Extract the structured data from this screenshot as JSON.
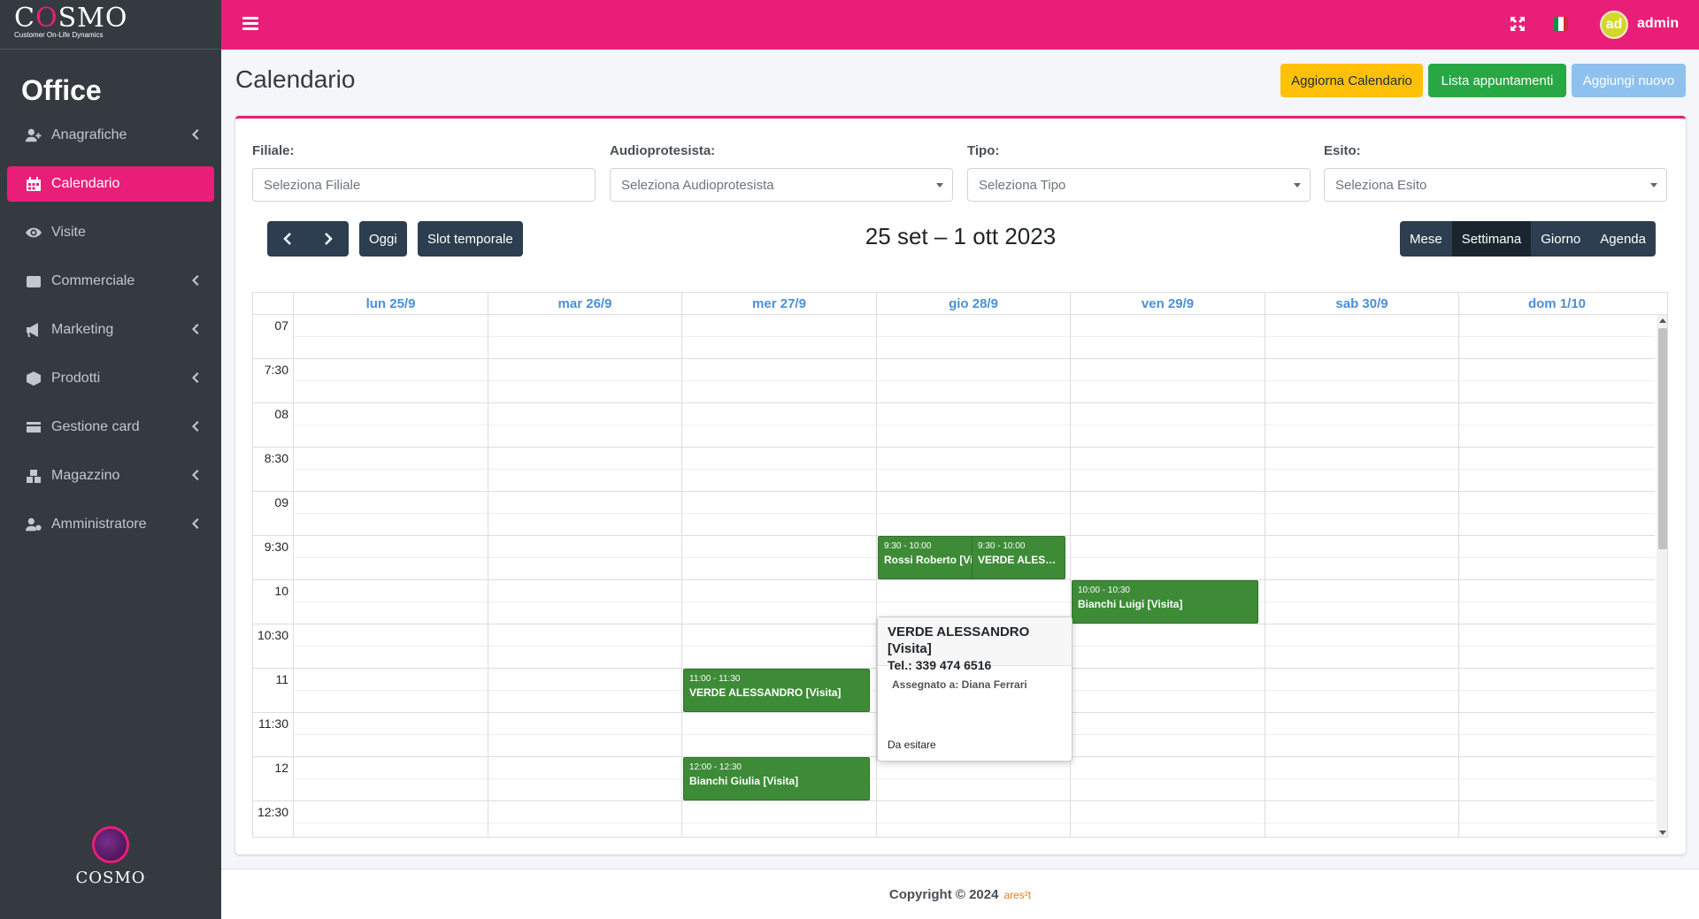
{
  "brand": {
    "logo_c": "C",
    "logo_o": "O",
    "logo_rest": "SMO",
    "subtitle": "Customer On-Life Dynamics"
  },
  "sidebar": {
    "title": "Office",
    "items": [
      {
        "label": "Anagrafiche",
        "icon": "user-plus-icon"
      },
      {
        "label": "Calendario",
        "icon": "calendar-icon"
      },
      {
        "label": "Visite",
        "icon": "eye-icon"
      },
      {
        "label": "Commerciale",
        "icon": "wallet-icon"
      },
      {
        "label": "Marketing",
        "icon": "megaphone-icon"
      },
      {
        "label": "Prodotti",
        "icon": "box-icon"
      },
      {
        "label": "Gestione card",
        "icon": "credit-card-icon"
      },
      {
        "label": "Magazzino",
        "icon": "warehouse-icon"
      },
      {
        "label": "Amministratore",
        "icon": "user-cog-icon"
      }
    ],
    "footer_text": "COSMO"
  },
  "topbar": {
    "avatar_initials": "ad",
    "username": "admin"
  },
  "page": {
    "title": "Calendario",
    "buttons": {
      "refresh": "Aggiorna Calendario",
      "list": "Lista appuntamenti",
      "add": "Aggiungi nuovo"
    }
  },
  "filters": [
    {
      "label": "Filiale:",
      "placeholder": "Seleziona Filiale"
    },
    {
      "label": "Audioprotesista:",
      "placeholder": "Seleziona Audioprotesista"
    },
    {
      "label": "Tipo:",
      "placeholder": "Seleziona Tipo"
    },
    {
      "label": "Esito:",
      "placeholder": "Seleziona Esito"
    }
  ],
  "toolbar": {
    "today": "Oggi",
    "slot": "Slot temporale",
    "range_title": "25 set – 1 ott 2023",
    "views": [
      "Mese",
      "Settimana",
      "Giorno",
      "Agenda"
    ],
    "active_view": "Settimana"
  },
  "calendar": {
    "days": [
      "lun 25/9",
      "mar 26/9",
      "mer 27/9",
      "gio 28/9",
      "ven 29/9",
      "sab 30/9",
      "dom 1/10"
    ],
    "times": [
      "07",
      "7:30",
      "08",
      "8:30",
      "09",
      "9:30",
      "10",
      "10:30",
      "11",
      "11:30",
      "12",
      "12:30"
    ],
    "events": [
      {
        "time": "9:30 - 10:00",
        "title": "Rossi Roberto [Visita]"
      },
      {
        "time": "9:30 - 10:00",
        "title": "VERDE ALESSANDRO [Visita]"
      },
      {
        "time": "10:00 - 10:30",
        "title": "Bianchi Luigi [Visita]"
      },
      {
        "time": "11:00 - 11:30",
        "title": "VERDE ALESSANDRO [Visita]"
      },
      {
        "time": "12:00 - 12:30",
        "title": "Bianchi Giulia [Visita]"
      }
    ],
    "event_color": "#3d8b37"
  },
  "popover": {
    "title": "VERDE ALESSANDRO [Visita]",
    "phone": "Tel.: 339 474 6516",
    "assigned": "Assegnato a: Diana Ferrari",
    "status": "Da esitare"
  },
  "footer": {
    "copyright": "Copyright © 2024",
    "brand": "ares²t"
  },
  "colors": {
    "accent": "#e91e78",
    "sidebar": "#343a40",
    "toolbar": "#2c3e50"
  }
}
